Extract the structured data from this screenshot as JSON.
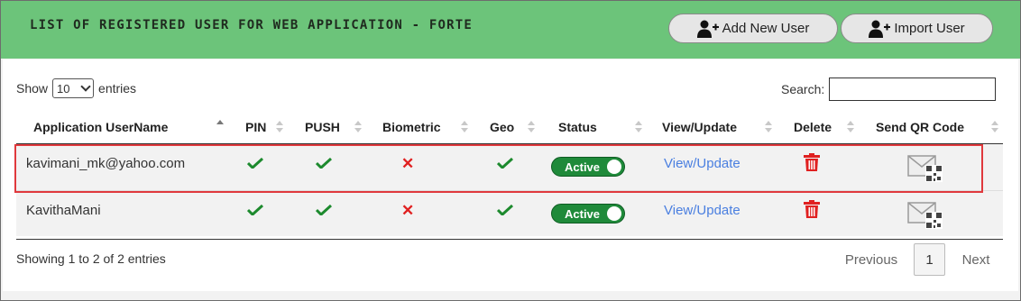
{
  "header": {
    "title": "LIST OF REGISTERED USER FOR WEB APPLICATION - FORTE",
    "add_button": "Add New User",
    "import_button": "Import User",
    "color": "#6cc47a"
  },
  "controls": {
    "show_label": "Show",
    "page_length": "10",
    "entries_label": "entries",
    "search_label": "Search:",
    "search_value": ""
  },
  "table": {
    "columns": [
      "Application UserName",
      "PIN",
      "PUSH",
      "Biometric",
      "Geo",
      "Status",
      "View/Update",
      "Delete",
      "Send QR Code"
    ],
    "rows": [
      {
        "username": "kavimani_mk@yahoo.com",
        "pin": "check",
        "push": "check",
        "biometric": "cross",
        "geo": "check",
        "status": "Active",
        "view": "View/Update",
        "highlighted": true
      },
      {
        "username": "KavithaMani",
        "pin": "check",
        "push": "check",
        "biometric": "cross",
        "geo": "check",
        "status": "Active",
        "view": "View/Update",
        "highlighted": false
      }
    ]
  },
  "footer": {
    "info": "Showing 1 to 2 of 2 entries",
    "previous": "Previous",
    "page": "1",
    "next": "Next"
  },
  "colors": {
    "check": "#1d8a2e",
    "cross": "#e02020",
    "link": "#4a7fe0",
    "toggle": "#1f8a3a",
    "delete": "#e02020",
    "highlight_border": "#e0393d"
  },
  "icons": {
    "add_user": "user-plus-icon",
    "import_user": "user-plus-icon",
    "check": "check-icon",
    "cross": "cross-icon",
    "delete": "trash-icon",
    "qr": "mail-qr-icon",
    "sort": "sort-icon"
  }
}
